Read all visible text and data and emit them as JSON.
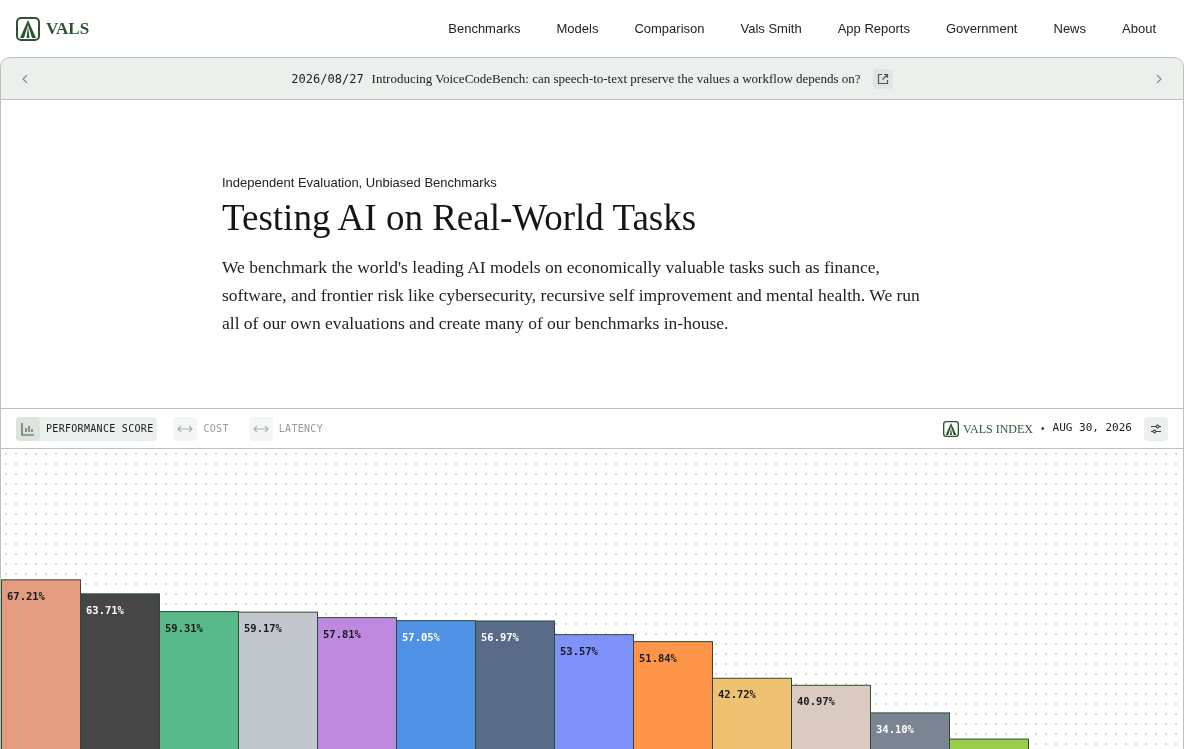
{
  "brand": {
    "name": "VALS"
  },
  "nav": [
    "Benchmarks",
    "Models",
    "Comparison",
    "Vals Smith",
    "App Reports",
    "Government",
    "News",
    "About"
  ],
  "announcement": {
    "date": "2026/08/27",
    "text": "Introducing VoiceCodeBench: can speech-to-text preserve the values a workflow depends on?"
  },
  "hero": {
    "eyebrow": "Independent Evaluation, Unbiased Benchmarks",
    "title": "Testing AI on Real-World Tasks",
    "body": "We benchmark the world's leading AI models on economically valuable tasks such as finance, software, and frontier risk like cybersecurity, recursive self improvement and mental health. We run all of our own evaluations and create many of our benchmarks in-house."
  },
  "metric_tabs": [
    {
      "label": "PERFORMANCE SCORE",
      "kind": "chart",
      "selected": true
    },
    {
      "label": "COST",
      "kind": "range",
      "selected": false
    },
    {
      "label": "LATENCY",
      "kind": "range",
      "selected": false
    }
  ],
  "index": {
    "name": "VALS INDEX",
    "separator": "•",
    "date": "AUG 30, 2026"
  },
  "chart_data": {
    "type": "bar",
    "values": [
      67.21,
      63.71,
      59.31,
      59.17,
      57.81,
      57.05,
      56.97,
      53.57,
      51.84,
      42.72,
      40.97,
      34.1,
      27.6
    ],
    "colors": [
      "#e49c80",
      "#464646",
      "#58b98a",
      "#c2c7ce",
      "#be8ae0",
      "#4f91e5",
      "#5a6a89",
      "#7f91fb",
      "#fe9548",
      "#efc172",
      "#dbcabf",
      "#7a8492",
      "#9ccd4a"
    ],
    "value_labels": [
      "67.21%",
      "63.71%",
      "59.31%",
      "59.17%",
      "57.81%",
      "57.05%",
      "56.97%",
      "53.57%",
      "51.84%",
      "42.72%",
      "40.97%",
      "34.10%",
      null
    ]
  }
}
